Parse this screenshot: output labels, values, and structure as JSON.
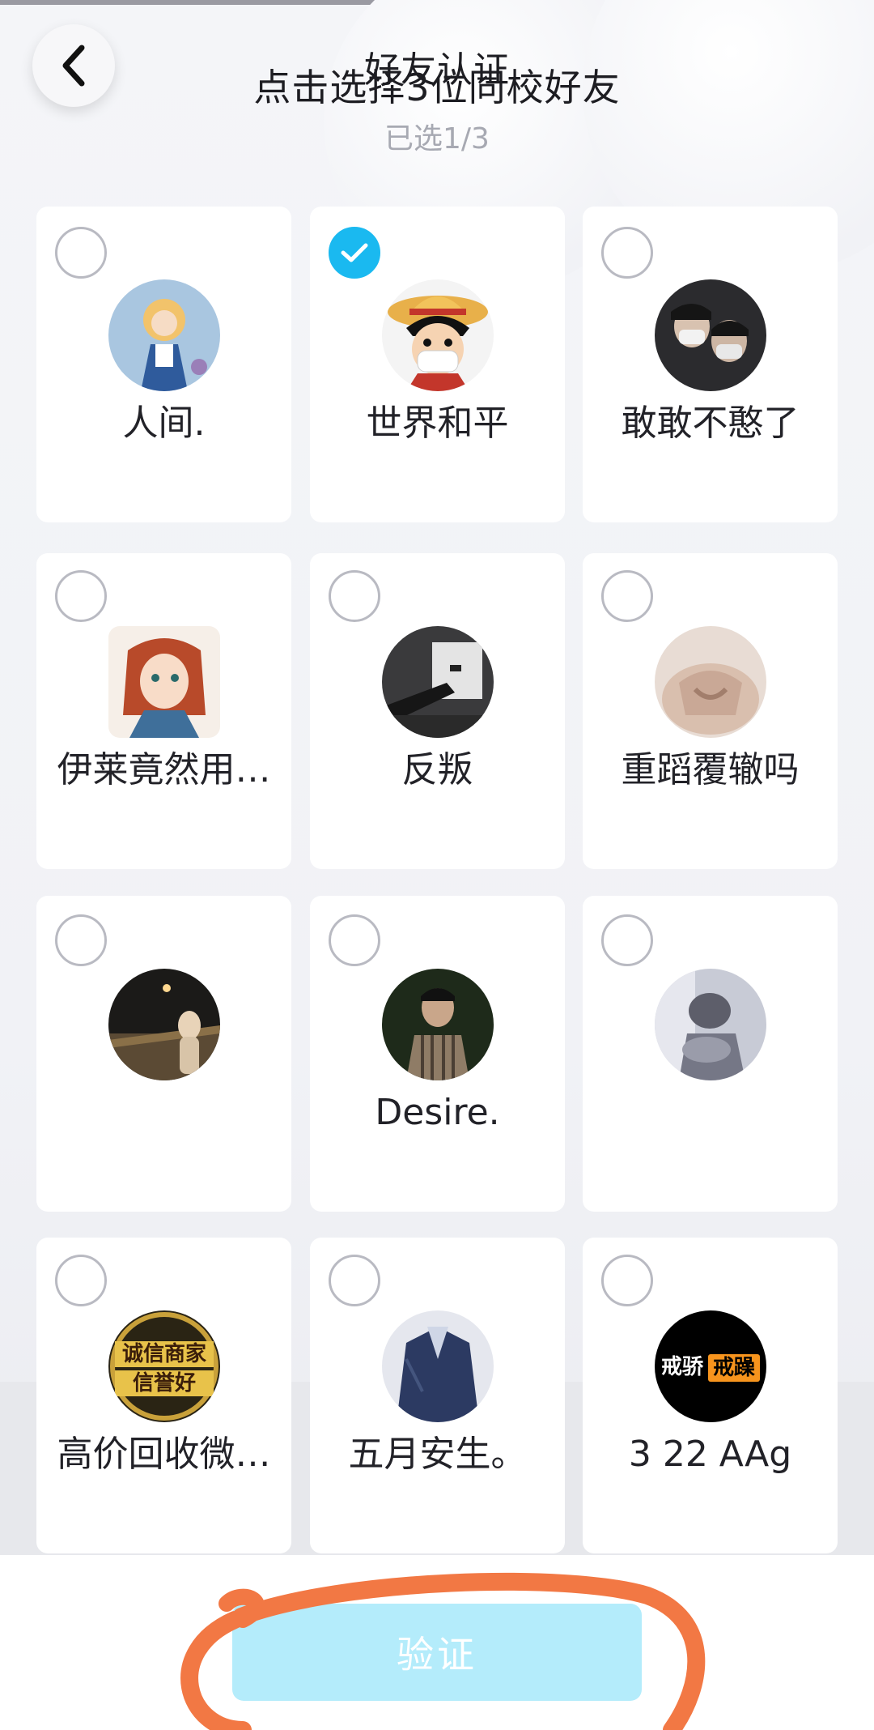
{
  "header": {
    "back_icon": "chevron-left-icon",
    "title": "好友认证",
    "instruction": "点击选择3位同校好友",
    "selected_count": "已选1/3"
  },
  "friends": [
    {
      "name": "人间.",
      "selected": false
    },
    {
      "name": "世界和平",
      "selected": true
    },
    {
      "name": "敢敢不憨了",
      "selected": false
    },
    {
      "name": "伊莱竟然用…",
      "selected": false
    },
    {
      "name": "反叛",
      "selected": false
    },
    {
      "name": "重蹈覆辙吗",
      "selected": false
    },
    {
      "name": "",
      "selected": false
    },
    {
      "name": "Desire.",
      "selected": false
    },
    {
      "name": "",
      "selected": false
    },
    {
      "name": "高价回收微…",
      "selected": false
    },
    {
      "name": "五月安生。",
      "selected": false
    },
    {
      "name": "3 22 AAg",
      "selected": false
    }
  ],
  "avatar_badges": {
    "logo1": "诚信商家",
    "logo2": "信誉好",
    "sign1": "戒骄",
    "sign2": "戒躁"
  },
  "footer": {
    "verify_label": "验证"
  },
  "colors": {
    "accent": "#1ab9f0",
    "button_disabled": "#b4ecfb",
    "annotation": "#f27844"
  }
}
